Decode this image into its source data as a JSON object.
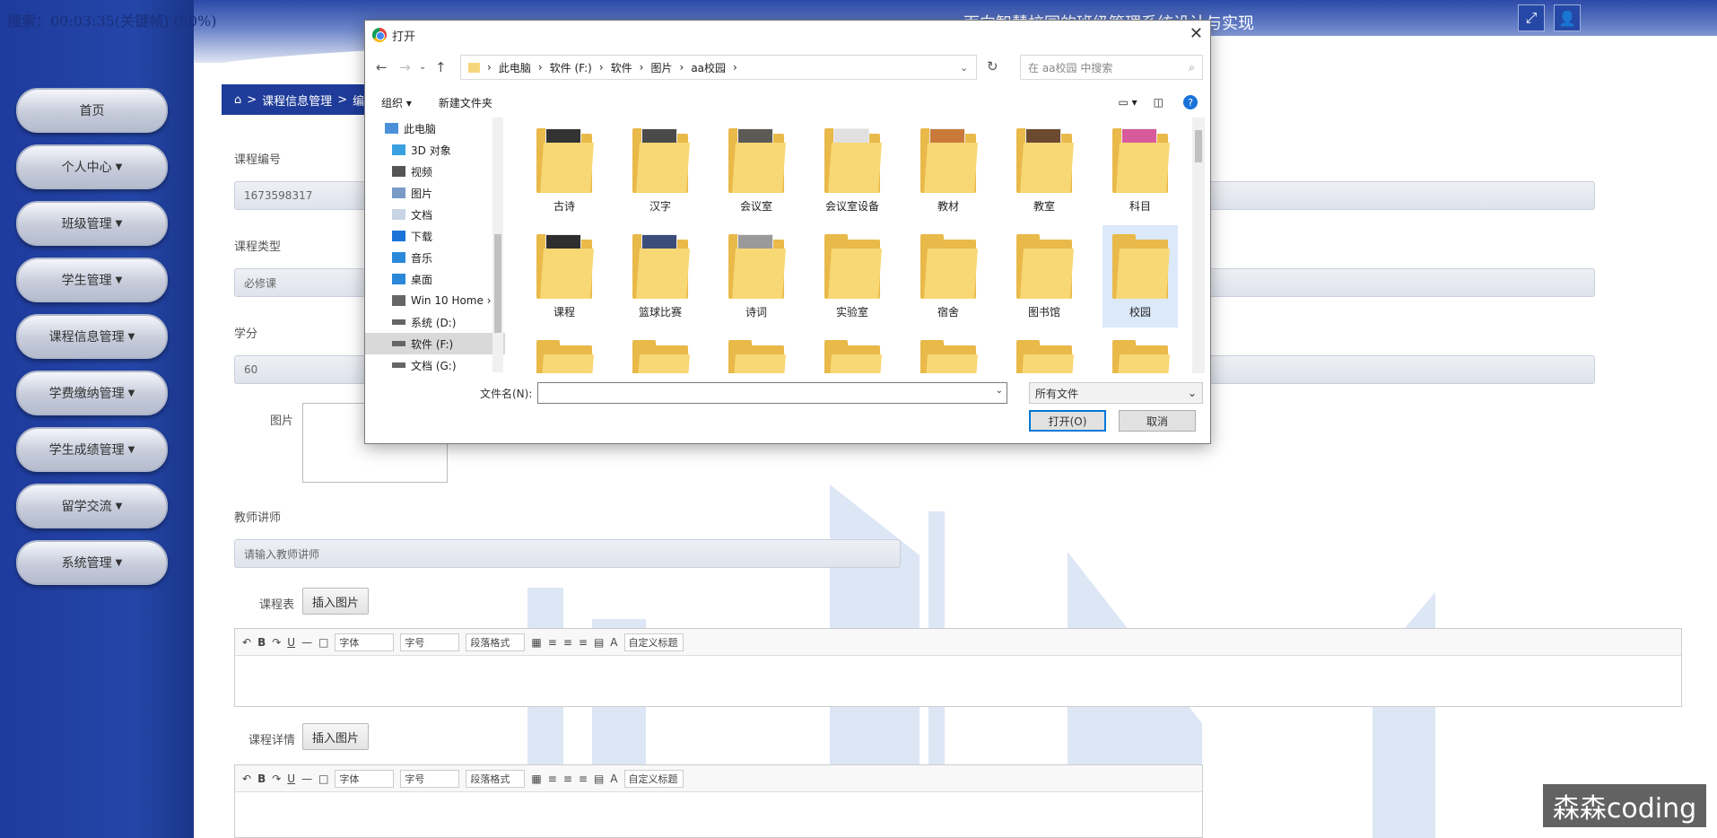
{
  "recording_caption": "搜索：00:03:35(关键帧) (50%)",
  "header": {
    "title": "面向智慧校园的班级管理系统设计与实现"
  },
  "sidebar": {
    "items": [
      {
        "label": "首页",
        "dropdown": false
      },
      {
        "label": "个人中心",
        "dropdown": true
      },
      {
        "label": "班级管理",
        "dropdown": true
      },
      {
        "label": "学生管理",
        "dropdown": true
      },
      {
        "label": "课程信息管理",
        "dropdown": true
      },
      {
        "label": "学费缴纳管理",
        "dropdown": true
      },
      {
        "label": "学生成绩管理",
        "dropdown": true
      },
      {
        "label": "留学交流",
        "dropdown": true
      },
      {
        "label": "系统管理",
        "dropdown": true
      }
    ]
  },
  "breadcrumb": {
    "crumb1": "课程信息管理",
    "crumb2": "编"
  },
  "form": {
    "course_no_label": "课程编号",
    "course_no_value": "1673598317",
    "course_type_label": "课程类型",
    "course_type_value": "必修课",
    "credit_label": "学分",
    "credit_value": "60",
    "image_label": "图片",
    "teacher_label": "教师讲师",
    "teacher_placeholder": "请输入教师讲师",
    "schedule_label": "课程表",
    "details_label": "课程详情",
    "insert_image": "插入图片"
  },
  "editor_toolbar": {
    "font": "字体",
    "size": "字号",
    "paragraph": "段落格式",
    "custom_title": "自定义标题"
  },
  "watermark": "森森coding",
  "dialog": {
    "title": "打开",
    "path": [
      "此电脑",
      "软件 (F:)",
      "软件",
      "图片",
      "aa校园"
    ],
    "search_placeholder": "在 aa校园 中搜索",
    "organize": "组织",
    "new_folder": "新建文件夹",
    "tree": [
      {
        "label": "此电脑",
        "icon": "computer-icon"
      },
      {
        "label": "3D 对象",
        "icon": "cube-icon"
      },
      {
        "label": "视频",
        "icon": "video-icon"
      },
      {
        "label": "图片",
        "icon": "picture-icon"
      },
      {
        "label": "文档",
        "icon": "document-icon"
      },
      {
        "label": "下载",
        "icon": "download-icon"
      },
      {
        "label": "音乐",
        "icon": "music-icon"
      },
      {
        "label": "桌面",
        "icon": "desktop-icon"
      },
      {
        "label": "Win 10 Home ›",
        "icon": "drive-icon"
      },
      {
        "label": "系统 (D:)",
        "icon": "drive-icon"
      },
      {
        "label": "软件 (F:)",
        "icon": "drive-icon"
      },
      {
        "label": "文档 (G:)",
        "icon": "drive-icon"
      }
    ],
    "folders": [
      {
        "label": "古诗",
        "preview": "#333333"
      },
      {
        "label": "汉字",
        "preview": "#4a4a4a"
      },
      {
        "label": "会议室",
        "preview": "#5b5a55"
      },
      {
        "label": "会议室设备",
        "preview": "#e0e0e0"
      },
      {
        "label": "教材",
        "preview": "#c97a3a"
      },
      {
        "label": "教室",
        "preview": "#6b4a30"
      },
      {
        "label": "科目",
        "preview": "#d95a9a"
      },
      {
        "label": "课程",
        "preview": "#2e2e2e"
      },
      {
        "label": "篮球比赛",
        "preview": "#3b4d7a"
      },
      {
        "label": "诗词",
        "preview": "#9a9a9a"
      },
      {
        "label": "实验室",
        "preview": ""
      },
      {
        "label": "宿舍",
        "preview": ""
      },
      {
        "label": "图书馆",
        "preview": ""
      },
      {
        "label": "校园",
        "preview": ""
      }
    ],
    "filename_label": "文件名(N):",
    "filetype": "所有文件",
    "open_button": "打开(O)",
    "cancel_button": "取消"
  }
}
